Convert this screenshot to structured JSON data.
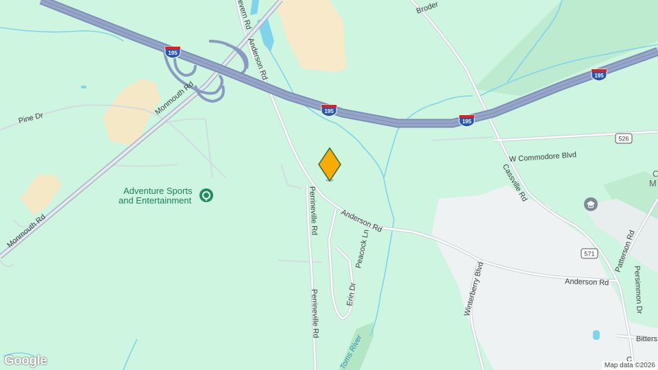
{
  "map": {
    "roads": {
      "interstate_shield": "195",
      "route_526": "526",
      "route_571": "571",
      "monmouth_rd_upper": "Monmouth Rd",
      "monmouth_rd_lower": "Monmouth Rd",
      "pine_dr": "Pine Dr",
      "severn_rd": "Severn Rd",
      "anderson_rd_north": "Anderson Rd",
      "anderson_rd_mid": "Anderson Rd",
      "anderson_rd_east": "Anderson Rd",
      "perrineville_rd_north": "Perrineville Rd",
      "perrineville_rd_south": "Perrineville Rd",
      "peacock_ln": "Peacock Ln",
      "erin_dr": "Erin Dr",
      "w_commodore_blvd": "W Commodore Blvd",
      "cassville_rd": "Cassville Rd",
      "winterberry_blvd": "Winterberry Blvd",
      "patterson_rd": "Patterson Rd",
      "persimmon_dr": "Persimmon Dr",
      "bittersweet": "Bitters",
      "broder": "Broder",
      "toms_river": "Toms River",
      "partial_c": "C",
      "partial_m": "M",
      "partial_c2": "C"
    },
    "poi": {
      "adventure_line1": "Adventure Sports",
      "adventure_line2": "and Entertainment"
    },
    "footer": {
      "logo": "Google",
      "attribution": "Map data ©2026"
    },
    "colors": {
      "land": "#cdf5df",
      "forest": "#b8ebcc",
      "developed": "#f1f3f4",
      "sand": "#f7e9c9",
      "water": "#7fd4ec",
      "highway": "#8a9bbf",
      "road": "#ffffff",
      "marker": "#f9ab00"
    }
  }
}
